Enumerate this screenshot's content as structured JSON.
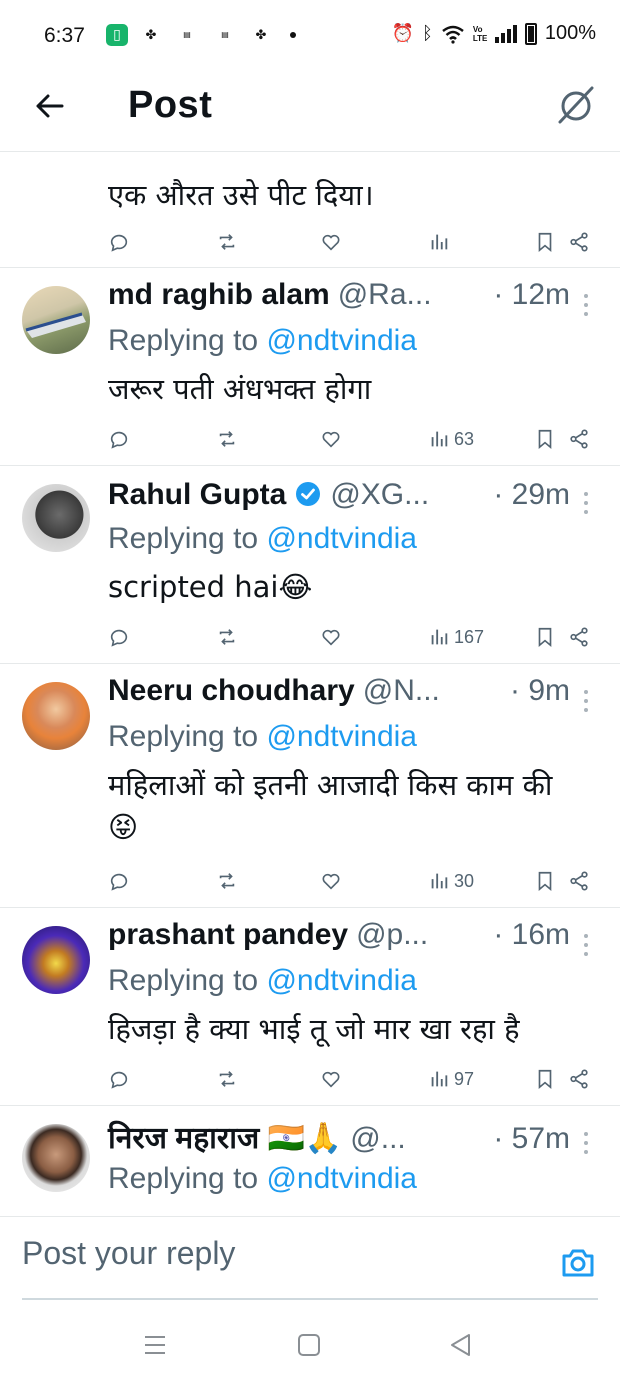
{
  "status_bar": {
    "time": "6:37",
    "battery": "100%",
    "network": "Vo LTE",
    "left_icons": [
      "app-icon-green",
      "pinwheel-icon",
      "news-icon",
      "news-icon",
      "pinwheel-icon",
      "dot"
    ],
    "right_icons": [
      "alarm-icon",
      "bluetooth-icon",
      "wifi-icon",
      "volte-icon",
      "signal-icon",
      "battery-icon"
    ]
  },
  "header": {
    "title": "Post",
    "back_icon": "arrow-left-icon",
    "right_icon": "grok-icon"
  },
  "first_tweet": {
    "body": "एक औरत उसे पीट दिया।",
    "views": ""
  },
  "tweets": [
    {
      "name": "md raghib alam",
      "handle": "@Ra...",
      "time": "· 12m",
      "verified": false,
      "replying_prefix": "Replying to ",
      "replying_to": "@ndtvindia",
      "body": "जरूर पती अंधभक्त होगा",
      "views": "63"
    },
    {
      "name": "Rahul Gupta",
      "handle": "@XG...",
      "time": "· 29m",
      "verified": true,
      "replying_prefix": "Replying to ",
      "replying_to": "@ndtvindia",
      "body": "scripted hai😂",
      "views": "167"
    },
    {
      "name": "Neeru choudhary",
      "handle": "@N...",
      "time": "· 9m",
      "verified": false,
      "replying_prefix": "Replying to ",
      "replying_to": "@ndtvindia",
      "body": "महिलाओं को इतनी आजादी किस काम की😝",
      "views": "30"
    },
    {
      "name": "prashant pandey",
      "handle": "@p...",
      "time": "· 16m",
      "verified": false,
      "replying_prefix": "Replying to ",
      "replying_to": "@ndtvindia",
      "body": "हिजड़ा है क्या भाई तू जो मार खा रहा है",
      "views": "97"
    },
    {
      "name": "निरज महाराज 🇮🇳🙏",
      "handle": "@...",
      "time": "· 57m",
      "verified": false,
      "replying_prefix": "Replying to ",
      "replying_to": "@ndtvindia",
      "body": "",
      "views": ""
    }
  ],
  "compose": {
    "placeholder": "Post your reply",
    "camera_icon": "camera-icon"
  },
  "nav": {
    "icons": [
      "recents-icon",
      "home-icon",
      "back-triangle-icon"
    ]
  },
  "colors": {
    "accent": "#1d9bf0",
    "text": "#0f1419",
    "secondary": "#536471",
    "divider": "#e6e9ea"
  }
}
